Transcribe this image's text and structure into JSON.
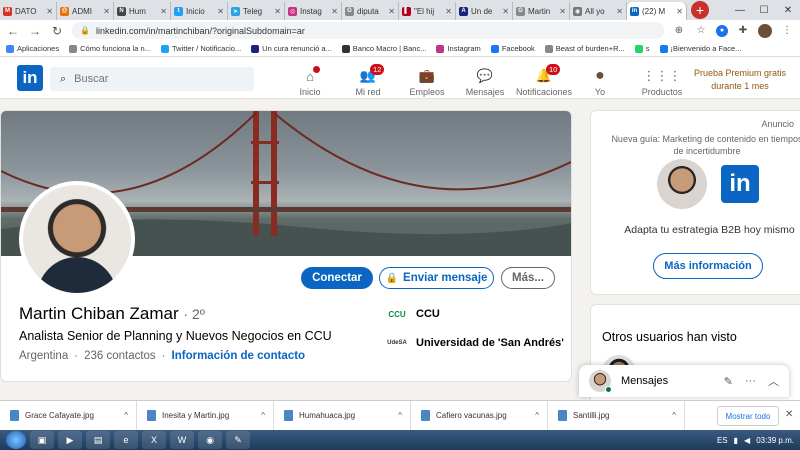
{
  "browser": {
    "tabs": [
      {
        "label": "DATO",
        "favicon": "gmail-icon",
        "color": "#d93025",
        "glyph": "M"
      },
      {
        "label": "ADMI",
        "favicon": "mail-icon",
        "color": "#e8710a",
        "glyph": "@"
      },
      {
        "label": "Hum",
        "favicon": "doc-icon",
        "color": "#444444",
        "glyph": "N"
      },
      {
        "label": "Inicio",
        "favicon": "twitter-icon",
        "color": "#1da1f2",
        "glyph": "t"
      },
      {
        "label": "Teleg",
        "favicon": "telegram-icon",
        "color": "#2aa3df",
        "glyph": "➤"
      },
      {
        "label": "Instag",
        "favicon": "instagram-icon",
        "color": "#c13584",
        "glyph": "◎"
      },
      {
        "label": "diputa",
        "favicon": "google-icon",
        "color": "#888888",
        "glyph": "G"
      },
      {
        "label": "\"El hij",
        "favicon": "bookmark-red-icon",
        "color": "#b3001b",
        "glyph": "▌"
      },
      {
        "label": "Un de",
        "favicon": "news-icon",
        "color": "#1a237e",
        "glyph": "A"
      },
      {
        "label": "Martin",
        "favicon": "google-icon",
        "color": "#888888",
        "glyph": "G"
      },
      {
        "label": "All yo",
        "favicon": "globe-icon",
        "color": "#777777",
        "glyph": "◉"
      },
      {
        "label": "(22) M",
        "favicon": "linkedin-icon",
        "color": "#0a66c2",
        "glyph": "in",
        "active": true
      }
    ],
    "url": "linkedin.com/in/martinchiban/?originalSubdomain=ar",
    "bookmarks": [
      {
        "label": "Aplicaciones",
        "color": "#4285f4"
      },
      {
        "label": "Cómo funciona la n...",
        "color": "#888888"
      },
      {
        "label": "Twitter / Notificacio...",
        "color": "#1da1f2"
      },
      {
        "label": "Un cura renunció a...",
        "color": "#1a237e"
      },
      {
        "label": "Banco Macro | Banc...",
        "color": "#333333"
      },
      {
        "label": "Instagram",
        "color": "#c13584"
      },
      {
        "label": "Facebook",
        "color": "#1877f2"
      },
      {
        "label": "Beast of burden+R...",
        "color": "#888888"
      },
      {
        "label": "s",
        "color": "#25d366"
      },
      {
        "label": "¡Bienvenido a Face...",
        "color": "#1877f2"
      }
    ]
  },
  "linkedin": {
    "logo": "in",
    "search_placeholder": "Buscar",
    "nav": [
      {
        "label": "Inicio",
        "icon": "home-icon",
        "badge": "dot"
      },
      {
        "label": "Mi red",
        "icon": "network-icon",
        "badge": "12"
      },
      {
        "label": "Empleos",
        "icon": "briefcase-icon",
        "badge": ""
      },
      {
        "label": "Mensajes",
        "icon": "chat-icon",
        "badge": ""
      },
      {
        "label": "Notificaciones",
        "icon": "bell-icon",
        "badge": "10"
      },
      {
        "label": "Yo",
        "icon": "me-avatar-icon",
        "badge": ""
      },
      {
        "label": "Productos",
        "icon": "grid-icon",
        "badge": ""
      }
    ],
    "premium": {
      "line1": "Prueba Premium gratis",
      "line2": "durante 1 mes"
    }
  },
  "profile": {
    "name": "Martin Chiban Zamar",
    "degree": "· 2º",
    "headline": "Analista Senior de Planning y Nuevos Negocios en CCU",
    "location": "Argentina",
    "connections": "236 contactos",
    "contact_info": "Información de contacto",
    "buttons": {
      "connect": "Conectar",
      "message": "Enviar mensaje",
      "more": "Más..."
    },
    "company": {
      "name": "CCU",
      "logo_text": "CCU"
    },
    "school": {
      "name": "Universidad de 'San Andrés'",
      "logo_text": "UdeSA"
    }
  },
  "ad": {
    "label": "Anuncio",
    "title": "Nueva guía: Marketing de contenido en tiempos de incertidumbre",
    "copy": "Adapta tu estrategia B2B hoy mismo",
    "button": "Más información"
  },
  "sidebar": {
    "others_title": "Otros usuarios han visto"
  },
  "messaging": {
    "title": "Mensajes"
  },
  "downloads": {
    "files": [
      "Grace Cafayate.jpg",
      "Inesita y Martin.jpg",
      "Humahuaca.jpg",
      "Cafiero vacunas.jpg",
      "Santilli.jpg"
    ],
    "show_all": "Mostrar todo"
  },
  "taskbar": {
    "lang": "ES",
    "time": "03:39 p.m."
  }
}
